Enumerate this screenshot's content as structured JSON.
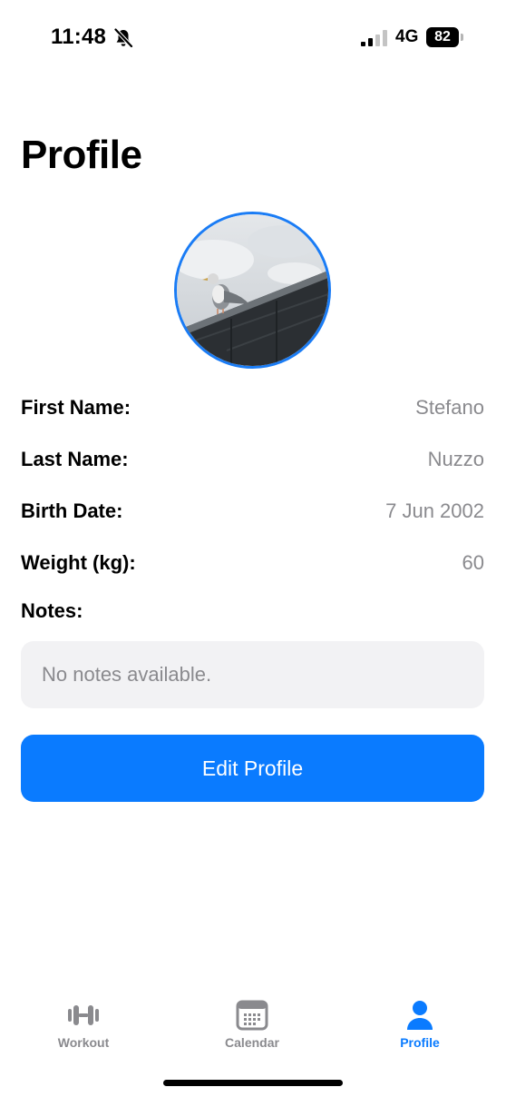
{
  "status_bar": {
    "time": "11:48",
    "silent_icon": "bell-slash-icon",
    "network": "4G",
    "battery_level": "82"
  },
  "page": {
    "title": "Profile"
  },
  "profile": {
    "avatar": "seagull-photo",
    "fields": [
      {
        "label": "First Name:",
        "value": "Stefano"
      },
      {
        "label": "Last Name:",
        "value": "Nuzzo"
      },
      {
        "label": "Birth Date:",
        "value": "7 Jun 2002"
      },
      {
        "label": "Weight (kg):",
        "value": "60"
      }
    ],
    "notes_label": "Notes:",
    "notes_text": "No notes available.",
    "edit_button_label": "Edit Profile"
  },
  "tab_bar": {
    "active": "Profile",
    "items": [
      {
        "label": "Workout",
        "icon": "dumbbell-icon"
      },
      {
        "label": "Calendar",
        "icon": "calendar-icon"
      },
      {
        "label": "Profile",
        "icon": "person-icon"
      }
    ]
  },
  "colors": {
    "accent": "#0a7bff",
    "secondary_text": "#8a8a8e",
    "notes_background": "#f2f2f4"
  }
}
